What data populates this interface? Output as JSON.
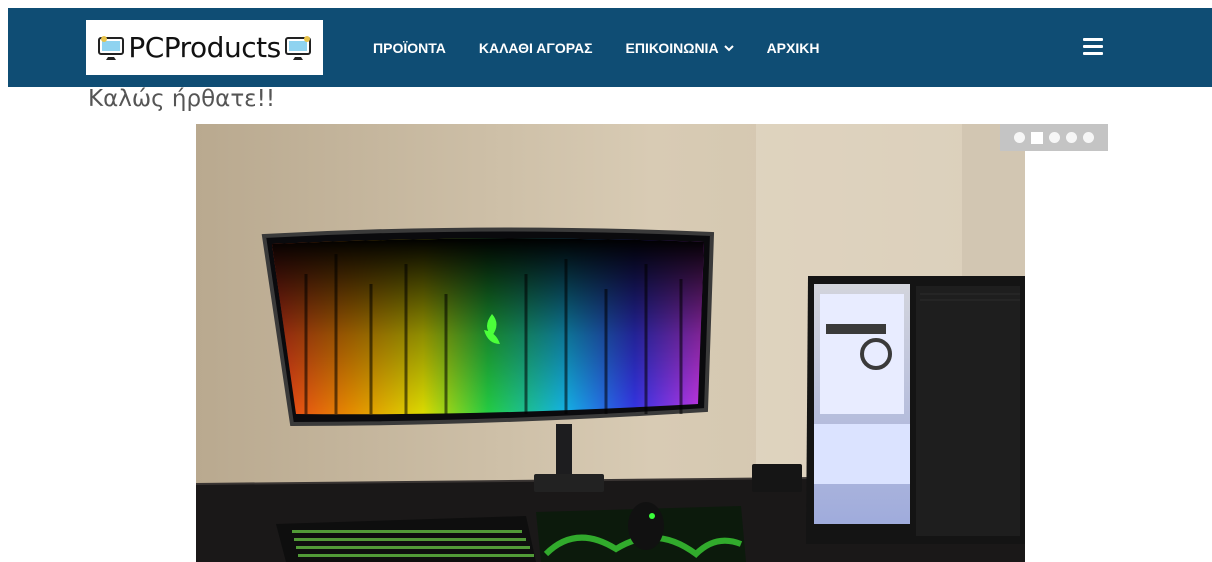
{
  "header": {
    "logo_text": "PCProducts",
    "nav": [
      {
        "label": "ΠΡΟΪΟΝΤΑ"
      },
      {
        "label": "ΚΑΛΑΘΙ ΑΓΟΡΑΣ"
      },
      {
        "label": "ΕΠΙΚΟΙΝΩΝΙΑ",
        "has_dropdown": true
      },
      {
        "label": "ΑΡΧΙΚΗ"
      }
    ],
    "menu_icon": "hamburger-menu-icon",
    "colors": {
      "bar": "#0f4d74",
      "text": "#ffffff"
    }
  },
  "main": {
    "welcome_text": "Καλώς ήρθατε!!"
  },
  "slider": {
    "dots_count": 5,
    "active_dot": 2
  }
}
